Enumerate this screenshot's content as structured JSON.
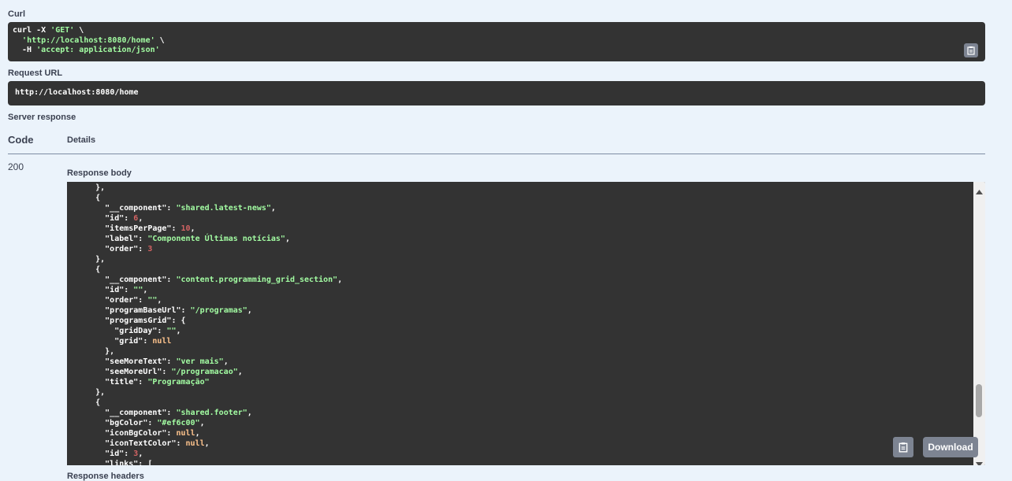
{
  "curl": {
    "label": "Curl",
    "lines": [
      [
        {
          "t": "curl -X ",
          "c": "key"
        },
        {
          "t": "'GET'",
          "c": "str"
        },
        {
          "t": " \\",
          "c": "key"
        }
      ],
      [
        {
          "t": "  ",
          "c": "key"
        },
        {
          "t": "'http://localhost:8080/home'",
          "c": "str"
        },
        {
          "t": " \\",
          "c": "key"
        }
      ],
      [
        {
          "t": "  -H ",
          "c": "key"
        },
        {
          "t": "'accept: application/json'",
          "c": "str"
        }
      ]
    ]
  },
  "request_url": {
    "label": "Request URL",
    "value": "http://localhost:8080/home"
  },
  "server_response": {
    "label": "Server response",
    "col_code": "Code",
    "col_details": "Details",
    "code": "200",
    "body_label": "Response body",
    "headers_label": "Response headers",
    "download_label": "Download",
    "lines": [
      [
        {
          "t": "      },",
          "c": "key"
        }
      ],
      [
        {
          "t": "      {",
          "c": "key"
        }
      ],
      [
        {
          "t": "        \"__component\": ",
          "c": "key"
        },
        {
          "t": "\"shared.latest-news\"",
          "c": "str"
        },
        {
          "t": ",",
          "c": "key"
        }
      ],
      [
        {
          "t": "        \"id\": ",
          "c": "key"
        },
        {
          "t": "6",
          "c": "num"
        },
        {
          "t": ",",
          "c": "key"
        }
      ],
      [
        {
          "t": "        \"itemsPerPage\": ",
          "c": "key"
        },
        {
          "t": "10",
          "c": "num"
        },
        {
          "t": ",",
          "c": "key"
        }
      ],
      [
        {
          "t": "        \"label\": ",
          "c": "key"
        },
        {
          "t": "\"Componente Últimas notícias\"",
          "c": "str"
        },
        {
          "t": ",",
          "c": "key"
        }
      ],
      [
        {
          "t": "        \"order\": ",
          "c": "key"
        },
        {
          "t": "3",
          "c": "num"
        }
      ],
      [
        {
          "t": "      },",
          "c": "key"
        }
      ],
      [
        {
          "t": "      {",
          "c": "key"
        }
      ],
      [
        {
          "t": "        \"__component\": ",
          "c": "key"
        },
        {
          "t": "\"content.programming_grid_section\"",
          "c": "str"
        },
        {
          "t": ",",
          "c": "key"
        }
      ],
      [
        {
          "t": "        \"id\": ",
          "c": "key"
        },
        {
          "t": "\"\"",
          "c": "str"
        },
        {
          "t": ",",
          "c": "key"
        }
      ],
      [
        {
          "t": "        \"order\": ",
          "c": "key"
        },
        {
          "t": "\"\"",
          "c": "str"
        },
        {
          "t": ",",
          "c": "key"
        }
      ],
      [
        {
          "t": "        \"programBaseUrl\": ",
          "c": "key"
        },
        {
          "t": "\"/programas\"",
          "c": "str"
        },
        {
          "t": ",",
          "c": "key"
        }
      ],
      [
        {
          "t": "        \"programsGrid\": {",
          "c": "key"
        }
      ],
      [
        {
          "t": "          \"gridDay\": ",
          "c": "key"
        },
        {
          "t": "\"\"",
          "c": "str"
        },
        {
          "t": ",",
          "c": "key"
        }
      ],
      [
        {
          "t": "          \"grid\": ",
          "c": "key"
        },
        {
          "t": "null",
          "c": "nul"
        }
      ],
      [
        {
          "t": "        },",
          "c": "key"
        }
      ],
      [
        {
          "t": "        \"seeMoreText\": ",
          "c": "key"
        },
        {
          "t": "\"ver mais\"",
          "c": "str"
        },
        {
          "t": ",",
          "c": "key"
        }
      ],
      [
        {
          "t": "        \"seeMoreUrl\": ",
          "c": "key"
        },
        {
          "t": "\"/programacao\"",
          "c": "str"
        },
        {
          "t": ",",
          "c": "key"
        }
      ],
      [
        {
          "t": "        \"title\": ",
          "c": "key"
        },
        {
          "t": "\"Programação\"",
          "c": "str"
        }
      ],
      [
        {
          "t": "      },",
          "c": "key"
        }
      ],
      [
        {
          "t": "      {",
          "c": "key"
        }
      ],
      [
        {
          "t": "        \"__component\": ",
          "c": "key"
        },
        {
          "t": "\"shared.footer\"",
          "c": "str"
        },
        {
          "t": ",",
          "c": "key"
        }
      ],
      [
        {
          "t": "        \"bgColor\": ",
          "c": "key"
        },
        {
          "t": "\"#ef6c00\"",
          "c": "str"
        },
        {
          "t": ",",
          "c": "key"
        }
      ],
      [
        {
          "t": "        \"iconBgColor\": ",
          "c": "key"
        },
        {
          "t": "null",
          "c": "nul"
        },
        {
          "t": ",",
          "c": "key"
        }
      ],
      [
        {
          "t": "        \"iconTextColor\": ",
          "c": "key"
        },
        {
          "t": "null",
          "c": "nul"
        },
        {
          "t": ",",
          "c": "key"
        }
      ],
      [
        {
          "t": "        \"id\": ",
          "c": "key"
        },
        {
          "t": "3",
          "c": "num"
        },
        {
          "t": ",",
          "c": "key"
        }
      ],
      [
        {
          "t": "        \"links\": [",
          "c": "key"
        }
      ]
    ]
  },
  "icons": {
    "copy": "clipboard-icon",
    "scroll_up": "chevron-up-icon",
    "scroll_down": "chevron-down-icon"
  },
  "colors": {
    "background": "#ebf3fb",
    "code_bg": "#333333",
    "string": "#a2fca2",
    "number": "#d36363",
    "null": "#fcc28c",
    "button": "#7d8492"
  }
}
